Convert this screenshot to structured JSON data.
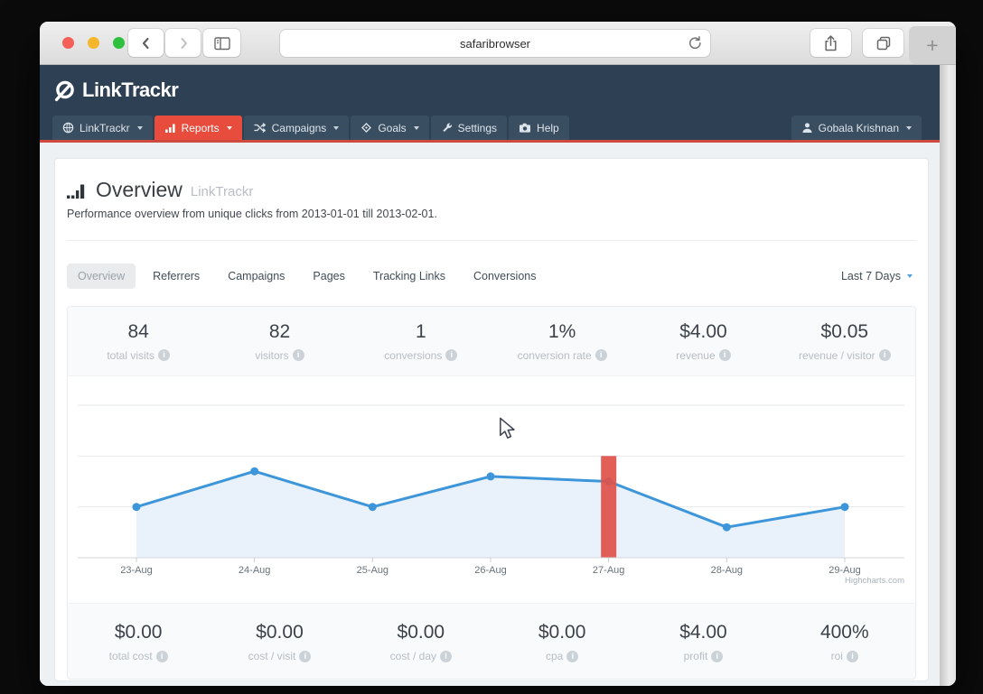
{
  "browser": {
    "url_text": "safaribrowser",
    "new_tab_label": "+"
  },
  "app": {
    "logo_text": "LinkTrackr"
  },
  "nav": {
    "items": [
      {
        "label": "LinkTrackr",
        "icon": "globe-icon",
        "caret": true,
        "active": false
      },
      {
        "label": "Reports",
        "icon": "bar-chart-icon",
        "caret": true,
        "active": true
      },
      {
        "label": "Campaigns",
        "icon": "shuffle-icon",
        "caret": true,
        "active": false
      },
      {
        "label": "Goals",
        "icon": "diamond-icon",
        "caret": true,
        "active": false
      },
      {
        "label": "Settings",
        "icon": "wrench-icon",
        "caret": false,
        "active": false
      },
      {
        "label": "Help",
        "icon": "camera-icon",
        "caret": false,
        "active": false
      }
    ],
    "user": {
      "label": "Gobala Krishnan",
      "icon": "user-icon",
      "caret": true
    }
  },
  "page": {
    "title": "Overview",
    "title_suffix": "LinkTrackr",
    "subtitle": "Performance overview from unique clicks from 2013-01-01 till 2013-02-01."
  },
  "tabs": {
    "items": [
      "Overview",
      "Referrers",
      "Campaigns",
      "Pages",
      "Tracking Links",
      "Conversions"
    ],
    "active_index": 0,
    "range_selector": "Last 7 Days"
  },
  "stats_top": [
    {
      "value": "84",
      "label": "total visits"
    },
    {
      "value": "82",
      "label": "visitors"
    },
    {
      "value": "1",
      "label": "conversions"
    },
    {
      "value": "1%",
      "label": "conversion rate"
    },
    {
      "value": "$4.00",
      "label": "revenue"
    },
    {
      "value": "$0.05",
      "label": "revenue / visitor"
    }
  ],
  "stats_bottom": [
    {
      "value": "$0.00",
      "label": "total cost"
    },
    {
      "value": "$0.00",
      "label": "cost / visit"
    },
    {
      "value": "$0.00",
      "label": "cost / day"
    },
    {
      "value": "$0.00",
      "label": "cpa"
    },
    {
      "value": "$4.00",
      "label": "profit"
    },
    {
      "value": "400%",
      "label": "roi"
    }
  ],
  "chart_data": {
    "type": "area",
    "x": [
      "23-Aug",
      "24-Aug",
      "25-Aug",
      "26-Aug",
      "27-Aug",
      "28-Aug",
      "29-Aug"
    ],
    "series": [
      {
        "name": "visits",
        "type": "line-area",
        "color": "#3d96d9",
        "values": [
          10,
          17,
          10,
          16,
          15,
          6,
          10
        ]
      },
      {
        "name": "highlight-column",
        "type": "column",
        "color": "#e0514a",
        "values": [
          null,
          null,
          null,
          null,
          20,
          null,
          null
        ]
      }
    ],
    "ylim": [
      0,
      30
    ],
    "gridline_step": 10,
    "grid": true,
    "legend": "none",
    "credits": "Highcharts.com"
  },
  "colors": {
    "navy": "#2e4154",
    "accent_red": "#e74c3c",
    "nav_red_line": "#cf4a3e",
    "chart_blue": "#3d96d9",
    "area_fill": "#e9f2fa",
    "page_bg": "#eef1f4"
  }
}
